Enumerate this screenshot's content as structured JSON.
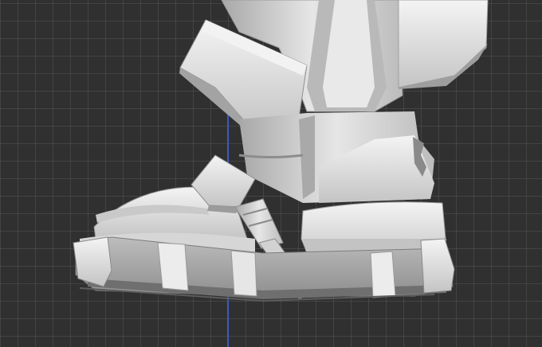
{
  "viewport": {
    "background_color": "#303030",
    "grid_color": "#444444",
    "vertical_axis_color": "#3a5fd0",
    "show_grid": true
  },
  "model": {
    "object": "armored-boot-3d-model",
    "shading": "gray-clay",
    "base_color": "#d8d8d8"
  }
}
